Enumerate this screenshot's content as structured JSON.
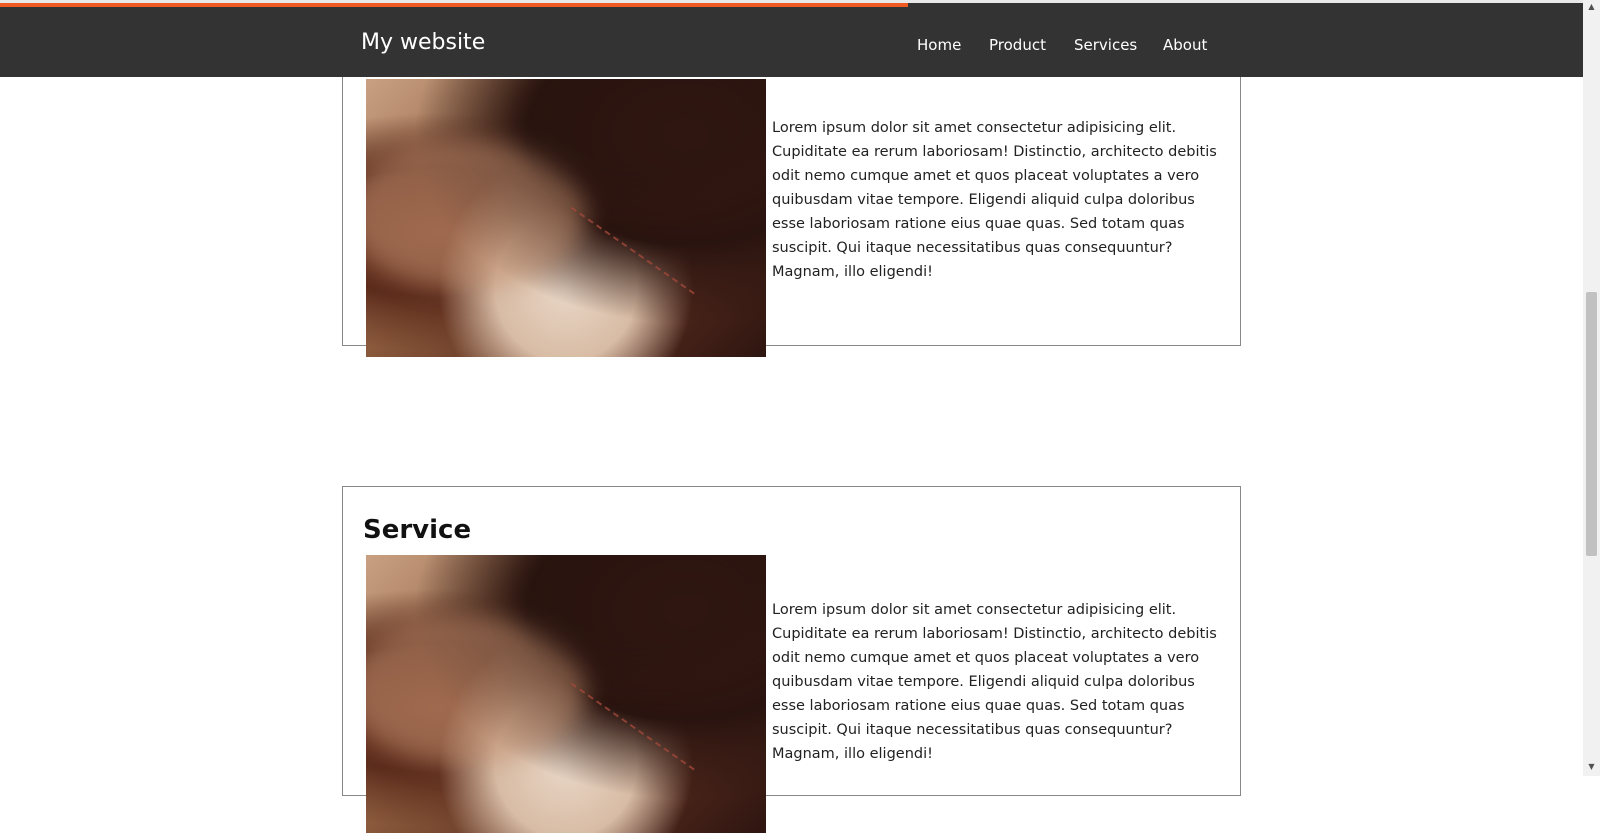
{
  "header": {
    "site_title": "My website",
    "nav": [
      "Home",
      "Product",
      "Services",
      "About"
    ],
    "accent_color": "#f05a24",
    "background_color": "#333333"
  },
  "sections": [
    {
      "heading": "",
      "image_icon": "baseball-glove-image",
      "text": "Lorem ipsum dolor sit amet consectetur adipisicing elit. Cupiditate ea rerum laboriosam! Distinctio, architecto debitis odit nemo cumque amet et quos placeat voluptates a vero quibusdam vitae tempore. Eligendi aliquid culpa doloribus esse laboriosam ratione eius quae quas. Sed totam quas suscipit. Qui itaque necessitatibus quas consequuntur? Magnam, illo eligendi!"
    },
    {
      "heading": "Service",
      "image_icon": "baseball-glove-image",
      "text": "Lorem ipsum dolor sit amet consectetur adipisicing elit. Cupiditate ea rerum laboriosam! Distinctio, architecto debitis odit nemo cumque amet et quos placeat voluptates a vero quibusdam vitae tempore. Eligendi aliquid culpa doloribus esse laboriosam ratione eius quae quas. Sed totam quas suscipit. Qui itaque necessitatibus quas consequuntur? Magnam, illo eligendi!"
    }
  ]
}
